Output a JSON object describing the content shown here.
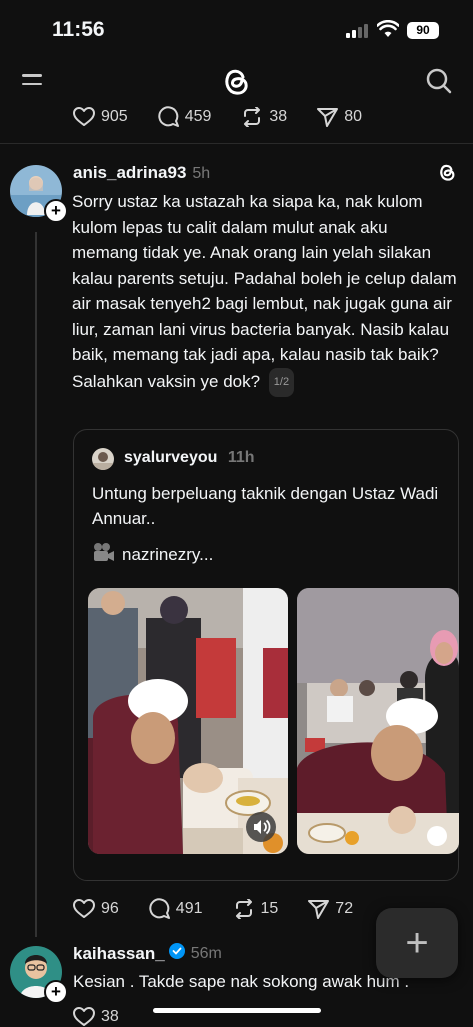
{
  "status_bar": {
    "time": "11:56",
    "battery": "90"
  },
  "header": {
    "menu_icon": "menu-icon",
    "logo_icon": "threads-logo-icon",
    "search_icon": "search-icon"
  },
  "prev_post": {
    "likes": "905",
    "replies": "459",
    "reposts": "38",
    "shares": "80"
  },
  "post": {
    "username": "anis_adrina93",
    "time": "5h",
    "text": "Sorry ustaz ka ustazah ka siapa ka, nak kulom kulom lepas tu calit dalam mulut anak aku memang tidak ye. Anak orang lain yelah silakan kalau parents setuju. Padahal boleh je celup dalam air masak tenyeh2 bagi lembut, nak jugak guna air liur, zaman lani virus bacteria banyak. Nasib kalau baik, memang tak jadi apa, kalau nasib tak baik? Salahkan vaksin ye dok?",
    "pager": "1/2",
    "quote": {
      "username": "syalurveyou",
      "time": "11h",
      "text": "Untung berpeluang taknik dengan Ustaz Wadi Annuar..",
      "video_credit": "nazrinezry..."
    },
    "likes": "96",
    "replies": "491",
    "reposts": "15",
    "shares": "72"
  },
  "next_post": {
    "username": "kaihassan_",
    "time": "56m",
    "text": "Kesian . Takde sape nak sokong awak hum .",
    "likes": "38"
  },
  "fab": {
    "label": "+"
  },
  "colors": {
    "background": "#101010",
    "text": "#f3f5f7",
    "muted": "#8a8a8a",
    "verified": "#0095f6"
  }
}
